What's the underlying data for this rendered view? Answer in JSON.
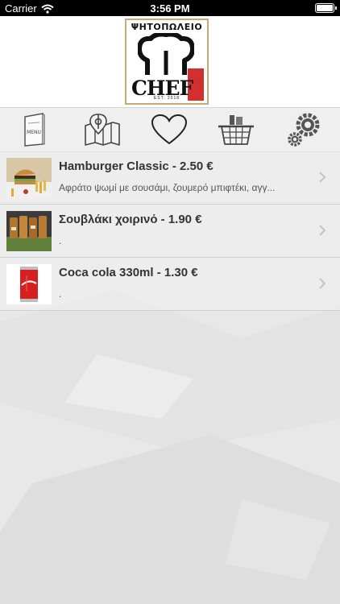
{
  "status_bar": {
    "carrier": "Carrier",
    "time": "3:56 PM"
  },
  "header": {
    "logo": {
      "top_text": "ΨΗΤΟΠΩΛΕΙΟ",
      "brand": "CHEF",
      "est": "EST. 2018"
    }
  },
  "toolbar": {
    "items": [
      {
        "icon": "menu-icon",
        "label": "MENU"
      },
      {
        "icon": "map-icon"
      },
      {
        "icon": "heart-icon"
      },
      {
        "icon": "basket-icon"
      },
      {
        "icon": "gear-icon"
      }
    ]
  },
  "items": [
    {
      "title": "Hamburger Classic - 2.50 €",
      "description": "Αφράτο ψωμί με σουσάμι, ζουμερό μπιφτέκι, αγγ..."
    },
    {
      "title": "Σουβλάκι χοιρινό - 1.90 €",
      "description": "."
    },
    {
      "title": "Coca cola 330ml - 1.30 €",
      "description": "."
    }
  ],
  "colors": {
    "accent": "#d32f2f",
    "header_bg": "#ffffff",
    "toolbar_bg": "#efefef",
    "text": "#333333"
  }
}
